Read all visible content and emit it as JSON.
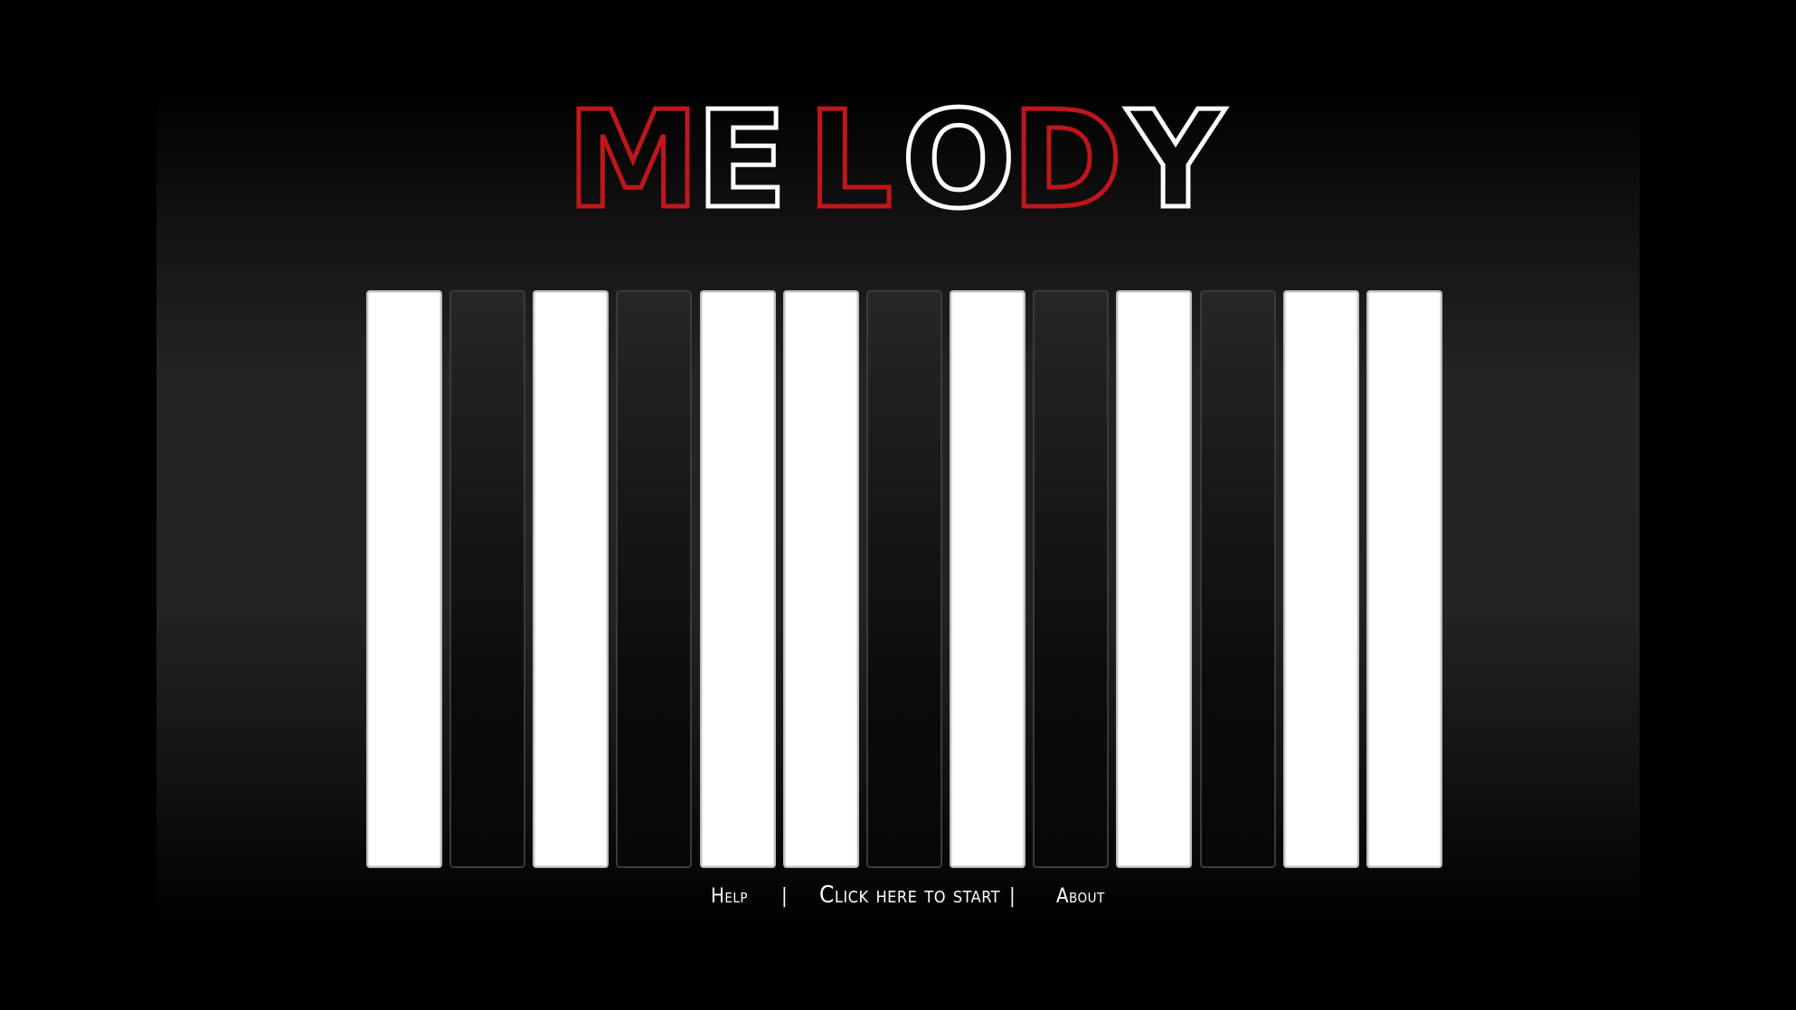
{
  "app": {
    "title": "MELODY",
    "title_letters": [
      {
        "char": "M",
        "color": "#c0161b"
      },
      {
        "char": "E",
        "color": "#ffffff"
      },
      {
        "char": "L",
        "color": "#c0161b"
      },
      {
        "char": "O",
        "color": "#ffffff"
      },
      {
        "char": "D",
        "color": "#c0161b"
      },
      {
        "char": "Y",
        "color": "#ffffff"
      }
    ]
  },
  "keys": [
    {
      "color": "white"
    },
    {
      "color": "black"
    },
    {
      "color": "white"
    },
    {
      "color": "black"
    },
    {
      "color": "white"
    },
    {
      "color": "white"
    },
    {
      "color": "black"
    },
    {
      "color": "white"
    },
    {
      "color": "black"
    },
    {
      "color": "white"
    },
    {
      "color": "black"
    },
    {
      "color": "white"
    },
    {
      "color": "white"
    }
  ],
  "footer": {
    "help_label": "Help",
    "separator": "|",
    "start_label": "Click here to start",
    "about_label": "About"
  },
  "colors": {
    "accent_red": "#c0161b",
    "background": "#000000",
    "white_key": "#ffffff"
  }
}
